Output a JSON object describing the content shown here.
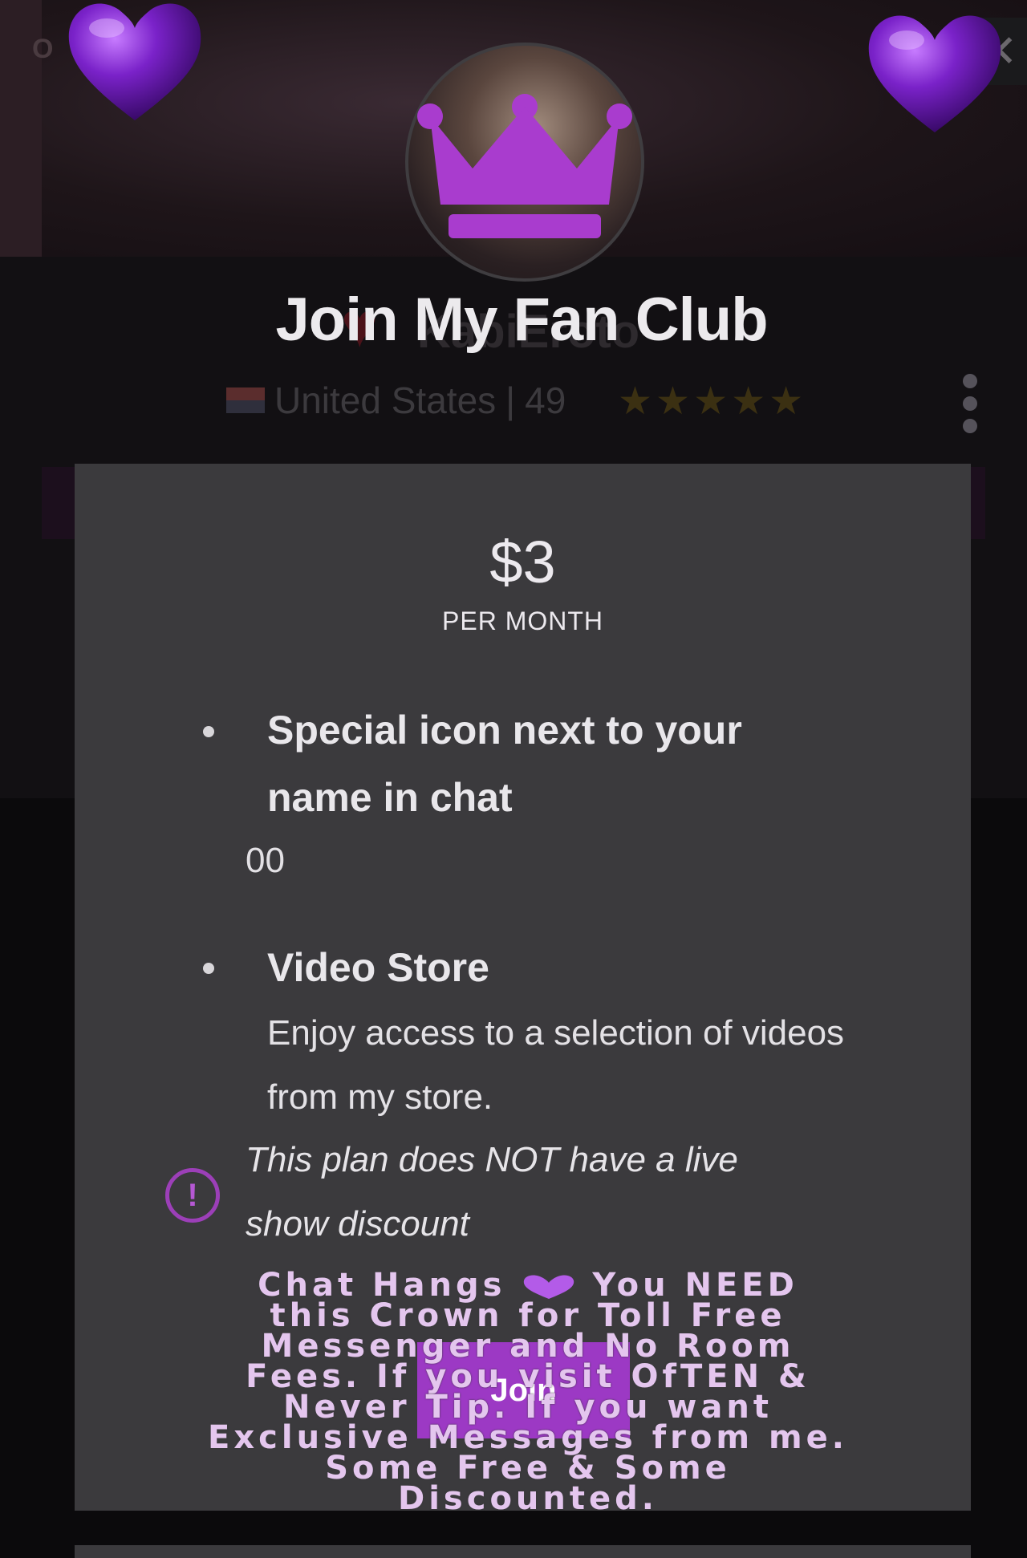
{
  "background": {
    "logo_text": "O",
    "profile_name": "KabiEroto",
    "country": "United States",
    "age": "49",
    "rating_stars": "★★★★★",
    "close_glyph": "✕"
  },
  "modal": {
    "title": "Join My Fan Club",
    "price": "$3",
    "period": "PER MONTH",
    "benefits": [
      {
        "title": "Special icon next to your name in chat",
        "description": "00"
      },
      {
        "title": "Video Store",
        "description": "Enjoy access to a selection of videos from my store."
      }
    ],
    "warning": "This plan does NOT have a live show discount",
    "warning_icon": "!",
    "join_label": "Join",
    "promo_lines": [
      "Chat Hangs",
      "You NEED",
      "this Crown for Toll Free",
      "Messenger and No Room",
      "Fees. If you visit OfTEN &",
      "Never Tip. If you want",
      "Exclusive Messages from me.",
      "Some Free & Some",
      "Discounted."
    ]
  },
  "colors": {
    "accent_purple": "#9c39c4",
    "card_bg": "#3b3a3d",
    "heart_purple": "#7a22c9"
  },
  "icons": [
    "heart-icon",
    "crown-icon",
    "alert-icon",
    "kebab-menu-icon",
    "close-icon",
    "star-icon",
    "flag-icon"
  ]
}
